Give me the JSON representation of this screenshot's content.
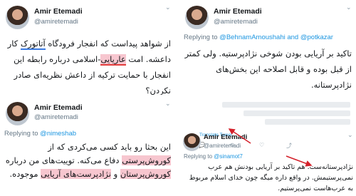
{
  "tweets": [
    {
      "name": "Amir Etemadi",
      "handle": "@amiretemadi",
      "reply_prefix": "",
      "reply_to": "",
      "text_parts": [
        "از شواهد پیداست که انفجار فرودگاه ",
        "آتاتورک",
        " کار داعشه. امت ",
        "عاریایی",
        "-اسلامی درباره رابطه این انفجار با حمایت ترکیه از داعش نظریه‌ای صادر نکردن؟"
      ]
    },
    {
      "name": "Amir Etemadi",
      "handle": "@amiretemadi",
      "reply_prefix": "Replying to ",
      "reply_to": "@BehnamAmoushahi and @potkazar",
      "text": "تاکید بر آریایی بودن شوخی نژادپرستیه. ولی کمتر از قبل بوده و قابل اصلاحه این بخش‌های نژادپرستانه."
    },
    {
      "name": "Amir Etemadi",
      "handle": "@amiretemadi",
      "reply_prefix": "Replying to ",
      "reply_to": "@nimeshab",
      "text_parts": [
        "این بحثا رو باید کسی می‌کردی که از ",
        "کوروش‌پرستی",
        " دفاع می‌کنه. توییت‌های من درباره ",
        "کوروش‌پرستان",
        " و ",
        "نژادپرست‌های آریایی",
        " موجوده."
      ]
    },
    {
      "name": "Amir Etemadi",
      "handle": "@amiretemadi",
      "reply_prefix": "Replying to ",
      "reply_to": "@sinamot7",
      "translate": "Translate Tweet",
      "text": "نژادپرستانه‌ست. هم تاکید بر آریایی بودنش هم عرب نمی‌پرستیمش. در واقع داره میگه چون خدای اسلام مربوط به عرب‌هاست نمی‌پرستیم."
    }
  ],
  "colors": {
    "link": "#1b95e0",
    "highlight": "#f7c6cf",
    "underline": "#e23b3b",
    "arrow": "#d4202a"
  }
}
